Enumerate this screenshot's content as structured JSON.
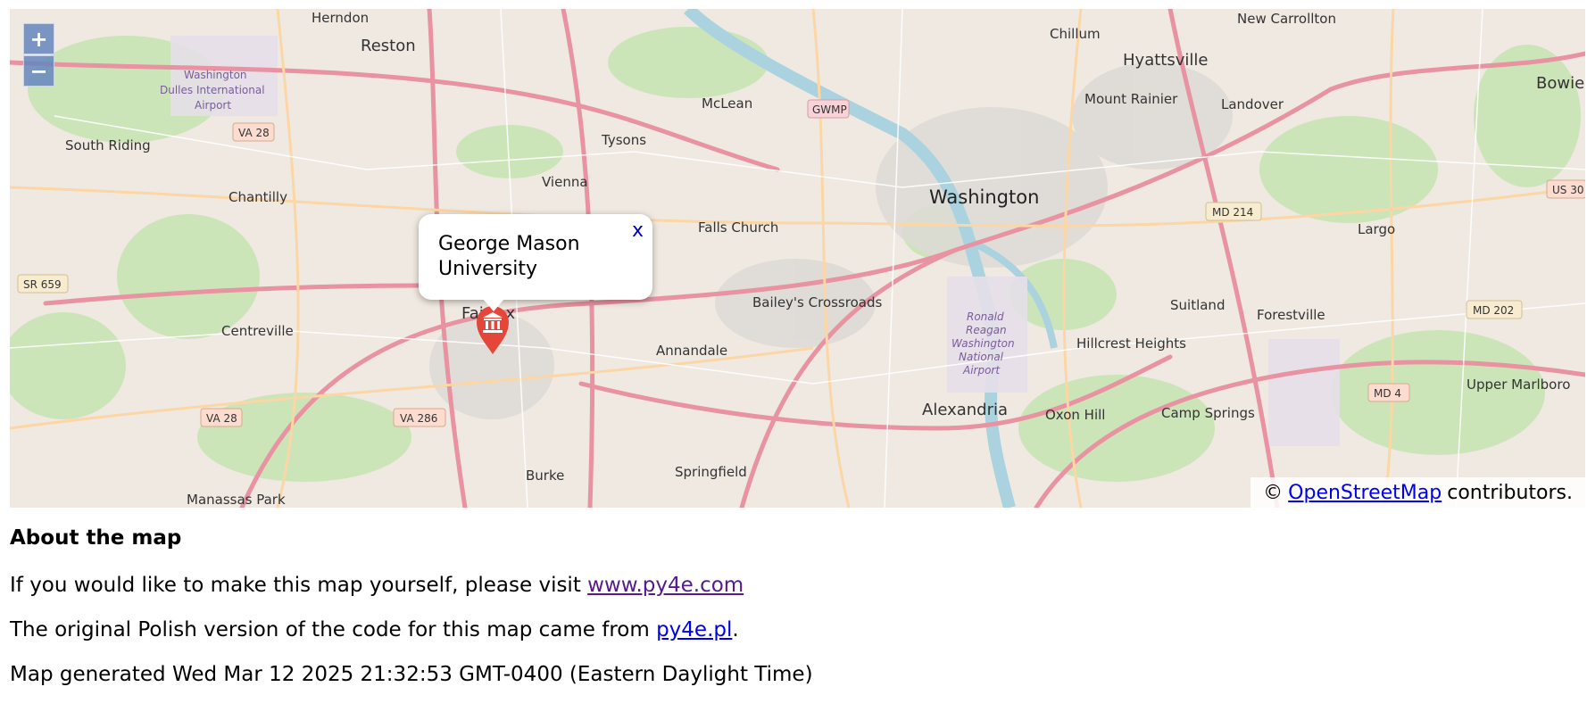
{
  "map": {
    "zoom_in_label": "+",
    "zoom_out_label": "−",
    "popup": {
      "text": "George Mason University",
      "close_label": "x"
    },
    "attribution": {
      "prefix": "©",
      "link_text": "OpenStreetMap",
      "suffix": "contributors."
    },
    "marker_icon": "university-marker-icon",
    "marker_color": "#e4473a",
    "places": {
      "herndon": "Herndon",
      "reston": "Reston",
      "washington_dulles": "Washington Dulles International Airport",
      "south_riding": "South Riding",
      "chantilly": "Chantilly",
      "centreville": "Centreville",
      "manassas_park": "Manassas Park",
      "vienna": "Vienna",
      "mclean": "McLean",
      "tysons": "Tysons",
      "falls_church": "Falls Church",
      "fairfax": "Fairfax",
      "annandale": "Annandale",
      "baileys": "Bailey's Crossroads",
      "burke": "Burke",
      "springfield": "Springfield",
      "alexandria": "Alexandria",
      "oxon_hill": "Oxon Hill",
      "camp_springs": "Camp Springs",
      "hillcrest": "Hillcrest Heights",
      "suitland": "Suitland",
      "forestville": "Forestville",
      "largo": "Largo",
      "upper_marlboro": "Upper Marlboro",
      "bowie": "Bowie",
      "washington": "Washington",
      "hyattsville": "Hyattsville",
      "mount_rainier": "Mount Rainier",
      "landover": "Landover",
      "new_carrollton": "New Carrollton",
      "chillum": "Chillum",
      "reagan": "Ronald Reagan Washington National Airport",
      "gwmp": "GWMP",
      "va28": "VA 28",
      "va28b": "VA 28",
      "va286": "VA 286",
      "sr659": "SR 659",
      "md214": "MD 214",
      "md202": "MD 202",
      "md4": "MD 4",
      "us30": "US 30"
    }
  },
  "about": {
    "heading": "About the map",
    "line1_text": "If you would like to make this map yourself, please visit ",
    "line1_link": "www.py4e.com",
    "line2_text": "The original Polish version of the code for this map came from ",
    "line2_link": "py4e.pl",
    "line2_end": ".",
    "generated": "Map generated Wed Mar 12 2025 21:32:53 GMT-0400 (Eastern Daylight Time)"
  }
}
